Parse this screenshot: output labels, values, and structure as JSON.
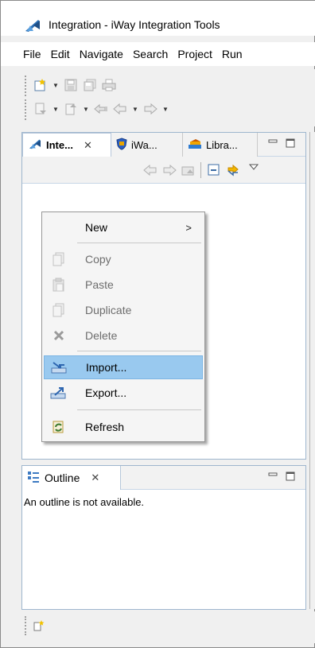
{
  "window": {
    "title": "Integration - iWay Integration Tools"
  },
  "menubar": {
    "items": [
      "File",
      "Edit",
      "Navigate",
      "Search",
      "Project",
      "Run"
    ]
  },
  "main_panel": {
    "tabs": [
      {
        "label": "Inte...",
        "close": "✕"
      },
      {
        "label": "iWa..."
      },
      {
        "label": "Libra..."
      }
    ]
  },
  "context_menu": {
    "items": [
      {
        "label": "New",
        "arrow": ">"
      },
      {
        "label": "Copy"
      },
      {
        "label": "Paste"
      },
      {
        "label": "Duplicate"
      },
      {
        "label": "Delete"
      },
      {
        "label": "Import..."
      },
      {
        "label": "Export..."
      },
      {
        "label": "Refresh"
      }
    ],
    "selected": "Import...",
    "disabled": [
      "Copy",
      "Paste",
      "Duplicate",
      "Delete"
    ]
  },
  "outline_panel": {
    "tab_label": "Outline",
    "tab_close": "✕",
    "message": "An outline is not available."
  },
  "colors": {
    "selection": "#99c9ef",
    "panel_border": "#9eb6ce"
  }
}
